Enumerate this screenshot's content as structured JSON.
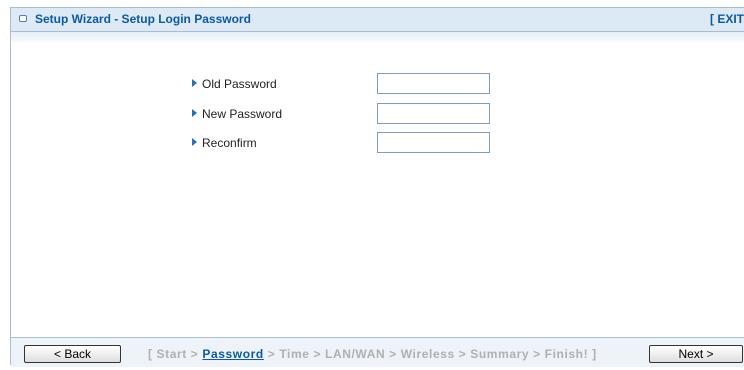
{
  "header": {
    "title": "Setup Wizard - Setup Login Password",
    "exit_label": "[ EXIT"
  },
  "form": {
    "fields": [
      {
        "label": "Old Password",
        "value": ""
      },
      {
        "label": "New Password",
        "value": ""
      },
      {
        "label": "Reconfirm",
        "value": ""
      }
    ]
  },
  "footer": {
    "back_label": "< Back",
    "next_label": "Next >",
    "steps": {
      "open": "[ ",
      "start": "Start",
      "sep": " > ",
      "password": "Password",
      "time": "Time",
      "lanwan": "LAN/WAN",
      "wireless": "Wireless",
      "summary": "Summary",
      "finish": "Finish!",
      "close": " ]"
    }
  },
  "colors": {
    "accent": "#0d5aa0",
    "title_bar": "#dde9f4",
    "inactive_step": "#b0b0b0"
  }
}
